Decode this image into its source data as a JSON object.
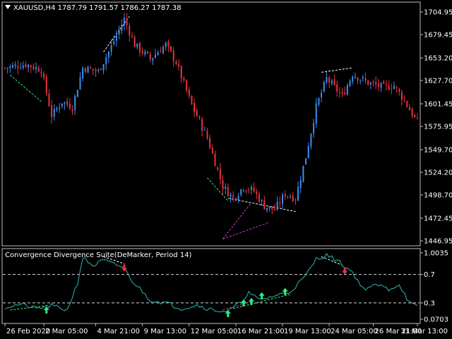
{
  "window": {
    "symbol_line": "XAUUSD,H4  1787.79 1791.57 1786.27 1787.38"
  },
  "indicator": {
    "title": "Convergence Divergence Suite(DeMarker, Period 14)"
  },
  "colors": {
    "background": "#000000",
    "frame": "#bfbfbf",
    "bull_candle": "#3a8ff0",
    "bear_candle": "#e8333f",
    "indicator_line": "#2fb8b8",
    "level_line": "#ffffff",
    "buy_arrow": "#2ef07a",
    "sell_arrow": "#e8333f",
    "divergence_green": "#2ef07a",
    "divergence_magenta": "#d23ad2",
    "divergence_white": "#ffffff"
  },
  "chart_data": [
    {
      "type": "candlestick",
      "title": "XAUUSD,H4  1787.79 1791.57 1786.27 1787.38",
      "y_ticks": [
        "1704.95",
        "1679.45",
        "1653.20",
        "1627.70",
        "1601.45",
        "1575.95",
        "1549.70",
        "1524.20",
        "1498.70",
        "1472.45",
        "1446.95"
      ],
      "ylim": [
        1446.95,
        1704.95
      ],
      "candle_count": 160,
      "close_path": [
        {
          "i": 0,
          "price": 1642
        },
        {
          "i": 8,
          "price": 1646
        },
        {
          "i": 14,
          "price": 1640
        },
        {
          "i": 18,
          "price": 1588
        },
        {
          "i": 22,
          "price": 1604
        },
        {
          "i": 26,
          "price": 1598
        },
        {
          "i": 30,
          "price": 1642
        },
        {
          "i": 36,
          "price": 1638
        },
        {
          "i": 40,
          "price": 1660
        },
        {
          "i": 46,
          "price": 1697
        },
        {
          "i": 50,
          "price": 1668
        },
        {
          "i": 56,
          "price": 1652
        },
        {
          "i": 62,
          "price": 1668
        },
        {
          "i": 66,
          "price": 1648
        },
        {
          "i": 72,
          "price": 1600
        },
        {
          "i": 78,
          "price": 1563
        },
        {
          "i": 84,
          "price": 1508
        },
        {
          "i": 88,
          "price": 1495
        },
        {
          "i": 92,
          "price": 1508
        },
        {
          "i": 96,
          "price": 1503
        },
        {
          "i": 100,
          "price": 1486
        },
        {
          "i": 104,
          "price": 1482
        },
        {
          "i": 108,
          "price": 1500
        },
        {
          "i": 112,
          "price": 1495
        },
        {
          "i": 116,
          "price": 1542
        },
        {
          "i": 120,
          "price": 1598
        },
        {
          "i": 124,
          "price": 1630
        },
        {
          "i": 130,
          "price": 1610
        },
        {
          "i": 134,
          "price": 1635
        },
        {
          "i": 140,
          "price": 1625
        },
        {
          "i": 146,
          "price": 1620
        },
        {
          "i": 150,
          "price": 1622
        },
        {
          "i": 154,
          "price": 1605
        },
        {
          "i": 159,
          "price": 1580
        }
      ],
      "divergence_lines": [
        {
          "color": "divergence_green",
          "from": {
            "i": 2,
            "price": 1634
          },
          "to": {
            "i": 14,
            "price": 1604
          }
        },
        {
          "color": "divergence_white",
          "from": {
            "i": 38,
            "price": 1660
          },
          "to": {
            "i": 48,
            "price": 1700
          }
        },
        {
          "color": "divergence_green",
          "from": {
            "i": 78,
            "price": 1518
          },
          "to": {
            "i": 86,
            "price": 1492
          }
        },
        {
          "color": "divergence_white",
          "from": {
            "i": 86,
            "price": 1495
          },
          "to": {
            "i": 112,
            "price": 1480
          }
        },
        {
          "color": "divergence_magenta",
          "from": {
            "i": 84,
            "price": 1449
          },
          "to": {
            "i": 95,
            "price": 1490
          }
        },
        {
          "color": "divergence_magenta",
          "from": {
            "i": 84,
            "price": 1449
          },
          "to": {
            "i": 102,
            "price": 1468
          }
        },
        {
          "color": "divergence_white",
          "from": {
            "i": 122,
            "price": 1637
          },
          "to": {
            "i": 134,
            "price": 1642
          }
        }
      ]
    },
    {
      "type": "line",
      "title": "Convergence Divergence Suite(DeMarker, Period 14)",
      "y_ticks": [
        "1.0035",
        "0.7",
        "0.3",
        "0.0703"
      ],
      "ylim": [
        0.0703,
        1.0035
      ],
      "levels": [
        0.7,
        0.3
      ],
      "series": [
        {
          "points": [
            {
              "i": 0,
              "v": 0.24
            },
            {
              "i": 6,
              "v": 0.28
            },
            {
              "i": 12,
              "v": 0.22
            },
            {
              "i": 18,
              "v": 0.26
            },
            {
              "i": 24,
              "v": 0.2
            },
            {
              "i": 28,
              "v": 0.58
            },
            {
              "i": 30,
              "v": 0.94
            },
            {
              "i": 34,
              "v": 0.82
            },
            {
              "i": 38,
              "v": 0.9
            },
            {
              "i": 42,
              "v": 0.84
            },
            {
              "i": 46,
              "v": 0.8
            },
            {
              "i": 48,
              "v": 0.65
            },
            {
              "i": 52,
              "v": 0.5
            },
            {
              "i": 56,
              "v": 0.34
            },
            {
              "i": 62,
              "v": 0.3
            },
            {
              "i": 68,
              "v": 0.22
            },
            {
              "i": 74,
              "v": 0.27
            },
            {
              "i": 80,
              "v": 0.2
            },
            {
              "i": 86,
              "v": 0.18
            },
            {
              "i": 90,
              "v": 0.28
            },
            {
              "i": 94,
              "v": 0.44
            },
            {
              "i": 98,
              "v": 0.34
            },
            {
              "i": 104,
              "v": 0.4
            },
            {
              "i": 110,
              "v": 0.46
            },
            {
              "i": 116,
              "v": 0.68
            },
            {
              "i": 120,
              "v": 0.92
            },
            {
              "i": 124,
              "v": 0.97
            },
            {
              "i": 128,
              "v": 0.9
            },
            {
              "i": 134,
              "v": 0.73
            },
            {
              "i": 138,
              "v": 0.5
            },
            {
              "i": 144,
              "v": 0.55
            },
            {
              "i": 148,
              "v": 0.49
            },
            {
              "i": 152,
              "v": 0.56
            },
            {
              "i": 156,
              "v": 0.3
            },
            {
              "i": 159,
              "v": 0.24
            }
          ]
        }
      ],
      "signal_arrows": [
        {
          "i": 16,
          "v": 0.2,
          "dir": "up",
          "color": "buy_arrow"
        },
        {
          "i": 46,
          "v": 0.79,
          "dir": "down",
          "color": "sell_arrow"
        },
        {
          "i": 86,
          "v": 0.15,
          "dir": "up",
          "color": "buy_arrow"
        },
        {
          "i": 92,
          "v": 0.3,
          "dir": "up",
          "color": "buy_arrow"
        },
        {
          "i": 95,
          "v": 0.32,
          "dir": "up",
          "color": "buy_arrow"
        },
        {
          "i": 99,
          "v": 0.4,
          "dir": "up",
          "color": "buy_arrow"
        },
        {
          "i": 108,
          "v": 0.46,
          "dir": "up",
          "color": "buy_arrow"
        },
        {
          "i": 131,
          "v": 0.75,
          "dir": "down",
          "color": "sell_arrow"
        }
      ],
      "divergence_lines": [
        {
          "color": "divergence_green",
          "from": {
            "i": 2,
            "v": 0.2
          },
          "to": {
            "i": 16,
            "v": 0.26
          }
        },
        {
          "color": "divergence_white",
          "from": {
            "i": 38,
            "v": 0.95
          },
          "to": {
            "i": 46,
            "v": 0.85
          }
        },
        {
          "color": "divergence_magenta",
          "from": {
            "i": 84,
            "v": 0.2
          },
          "to": {
            "i": 95,
            "v": 0.32
          }
        },
        {
          "color": "divergence_green",
          "from": {
            "i": 88,
            "v": 0.22
          },
          "to": {
            "i": 110,
            "v": 0.42
          }
        },
        {
          "color": "divergence_white",
          "from": {
            "i": 122,
            "v": 0.95
          },
          "to": {
            "i": 130,
            "v": 0.83
          }
        }
      ]
    }
  ],
  "time_axis": [
    {
      "i": 0,
      "label": "26 Feb 2020"
    },
    {
      "i": 15,
      "label": "2 Mar 05:00"
    },
    {
      "i": 35,
      "label": "4 Mar 21:00"
    },
    {
      "i": 53,
      "label": "9 Mar 13:00"
    },
    {
      "i": 71,
      "label": "12 Mar 05:00"
    },
    {
      "i": 89,
      "label": "16 Mar 21:00"
    },
    {
      "i": 107,
      "label": "19 Mar 13:00"
    },
    {
      "i": 125,
      "label": "24 Mar 05:00"
    },
    {
      "i": 142,
      "label": "26 Mar 21:00"
    },
    {
      "i": 159,
      "label": "31 Mar 13:00"
    }
  ]
}
